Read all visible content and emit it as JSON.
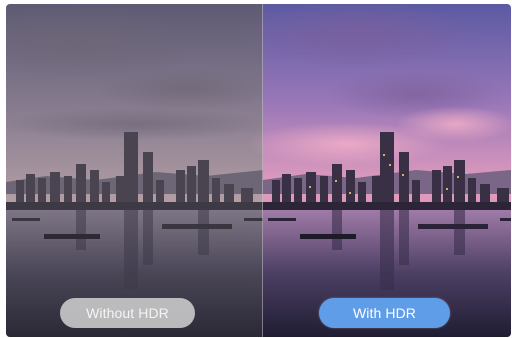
{
  "comparison": {
    "left_label": "Without HDR",
    "right_label": "With HDR"
  },
  "colors": {
    "badge_without": "#cdcdcd",
    "badge_with": "#5f9de8"
  }
}
